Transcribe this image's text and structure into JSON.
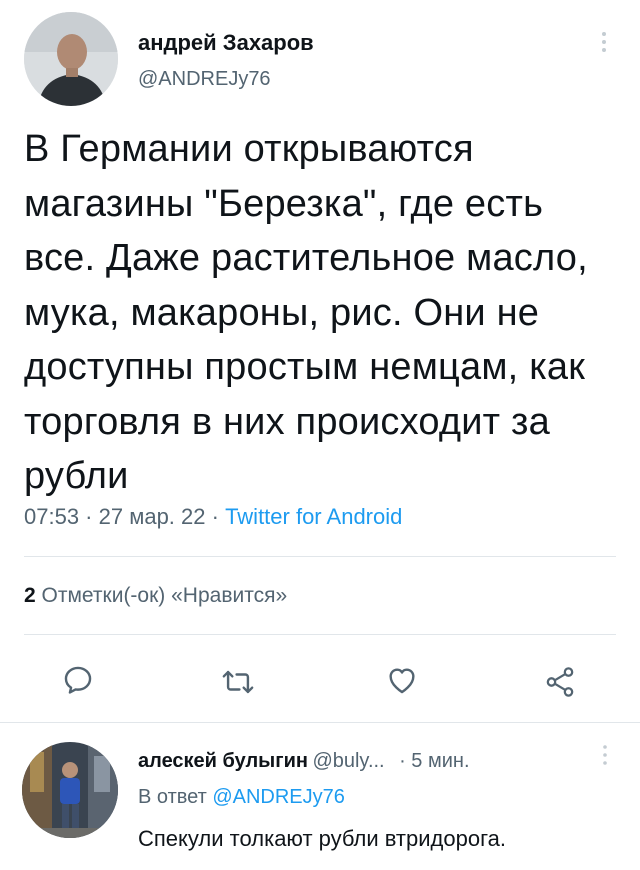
{
  "tweet": {
    "author_name": "андрей Захаров",
    "author_handle": "@ANDREJy76",
    "text": "В Германии открываются магазины \"Березка\", где есть все. Даже растительное масло, мука, макароны, рис. Они не доступны простым немцам, как торговля в них происходит за рубли",
    "time": "07:53",
    "date": "27 мар. 22",
    "source": "Twitter for Android",
    "separator": " · ",
    "likes_count": "2",
    "likes_label": "Отметки(-ок) «Нравится»"
  },
  "actions": [
    {
      "name": "reply",
      "icon": "reply-icon"
    },
    {
      "name": "retweet",
      "icon": "retweet-icon"
    },
    {
      "name": "like",
      "icon": "heart-icon"
    },
    {
      "name": "share",
      "icon": "share-icon"
    }
  ],
  "reply": {
    "author_name": "алескей булыгин",
    "author_handle": "@buly...",
    "time": "· 5 мин.",
    "reply_to_prefix": "В ответ",
    "reply_to_handle": "@ANDREJy76",
    "text": "Спекули толкают рубли втридорога."
  },
  "colors": {
    "text": "#0f1419",
    "secondary": "#536471",
    "accent": "#1d9bf0",
    "divider": "#e1e6ea"
  }
}
